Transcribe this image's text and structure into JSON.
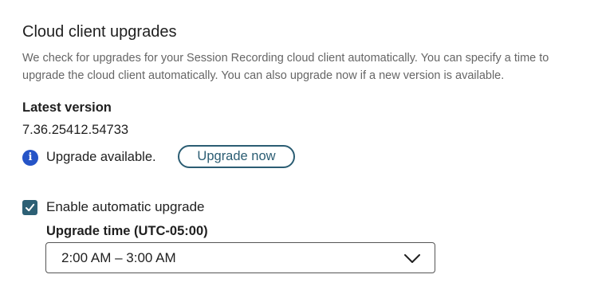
{
  "section": {
    "title": "Cloud client upgrades",
    "description": "We check for upgrades for your Session Recording cloud client automatically. You can specify a time to upgrade the cloud client automatically. You can also upgrade now if a new version is available."
  },
  "latest_version": {
    "label": "Latest version",
    "value": "7.36.25412.54733"
  },
  "upgrade_notice": {
    "icon": "info-icon",
    "icon_glyph": "i",
    "text": "Upgrade available.",
    "button_label": "Upgrade now"
  },
  "auto_upgrade": {
    "checked": true,
    "label": "Enable automatic upgrade",
    "time_label": "Upgrade time (UTC-05:00)",
    "selected_time": "2:00 AM – 3:00 AM"
  },
  "colors": {
    "accent": "#2b5d73",
    "info": "#2554c7",
    "checkbox": "#2d6075"
  }
}
